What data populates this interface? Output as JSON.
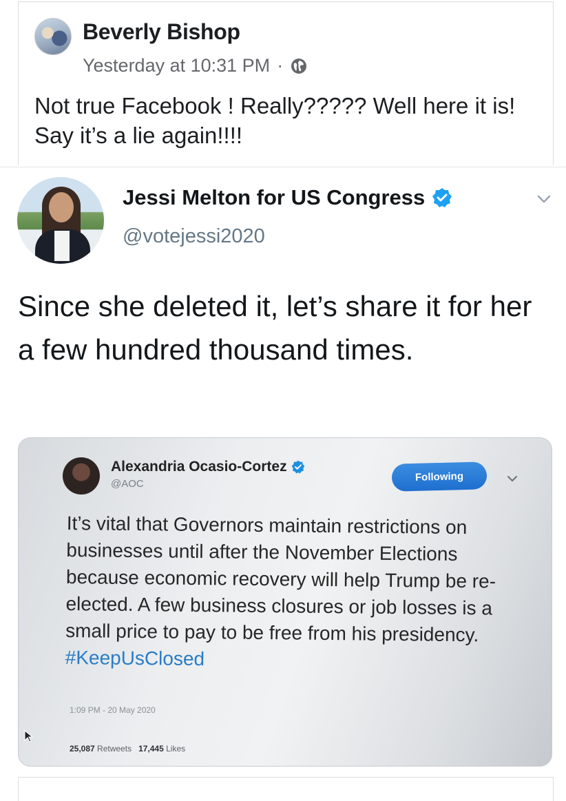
{
  "facebook_post": {
    "author": "Beverly Bishop",
    "timestamp": "Yesterday at 10:31 PM",
    "separator": "·",
    "privacy_icon": "globe-icon",
    "text": "Not true Facebook !  Really????? Well here it is!  Say it’s a lie again!!!!"
  },
  "tweet": {
    "display_name": "Jessi Melton for US Congress",
    "handle": "@votejessi2020",
    "text": "Since she deleted it, let’s share it for her a few hundred thousand times.",
    "verified_color": "#1da1f2"
  },
  "embedded_tweet": {
    "display_name": "Alexandria Ocasio-Cortez",
    "handle": "@AOC",
    "follow_label": "Following",
    "text": "It’s vital that Governors maintain restrictions on businesses until after the November Elections because economic recovery will help Trump be re-elected. A few business closures or job losses is a small price to pay to be free from his presidency.",
    "hashtag": "#KeepUsClosed",
    "time": "1:09 PM - 20 May 2020",
    "retweets_count": "25,087",
    "retweets_label": "Retweets",
    "likes_count": "17,445",
    "likes_label": "Likes"
  }
}
